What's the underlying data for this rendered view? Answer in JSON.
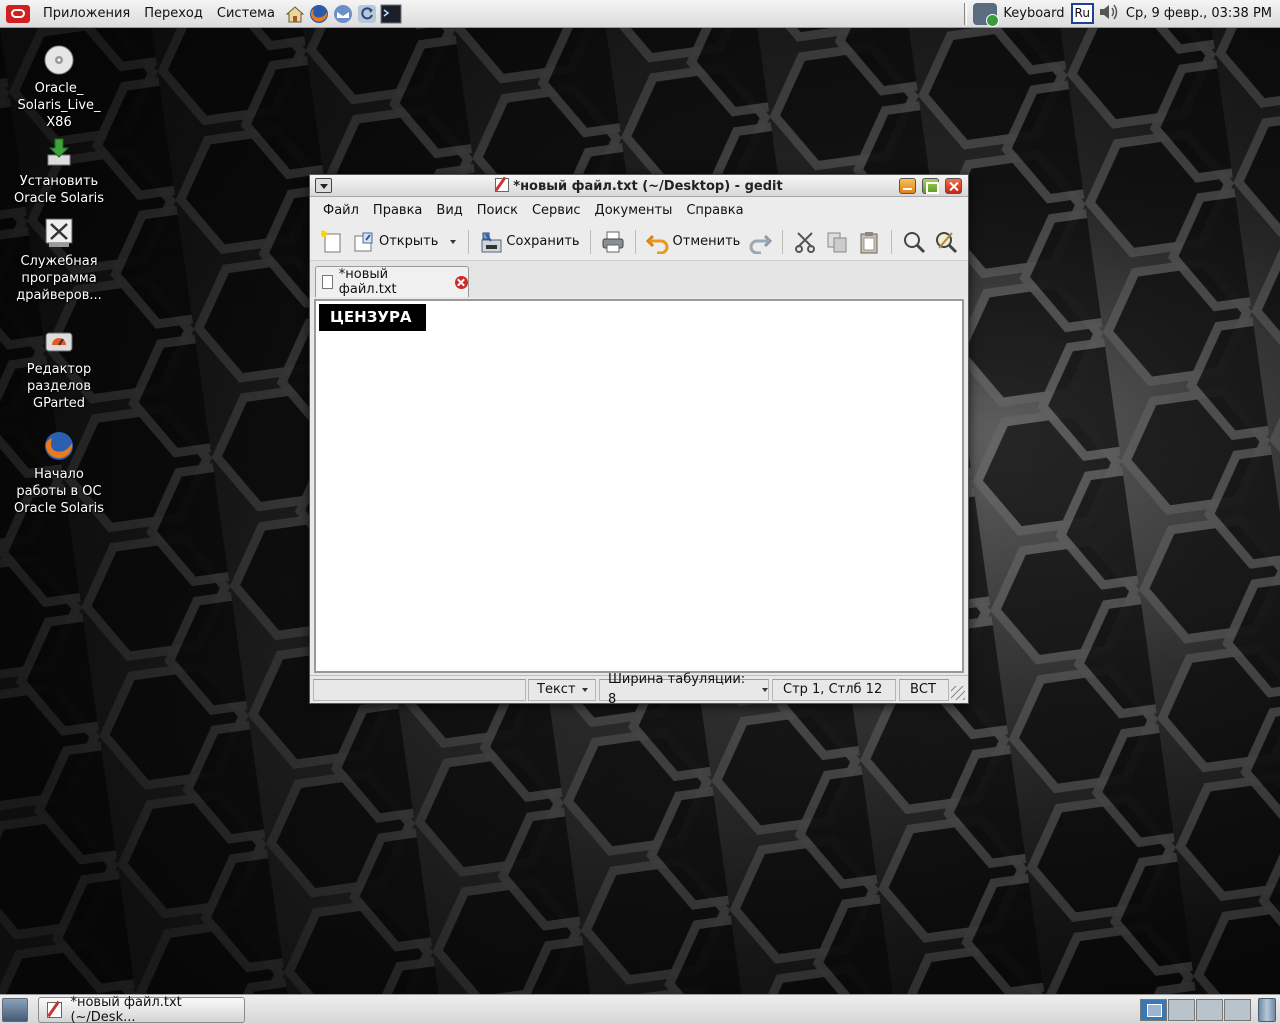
{
  "top_panel": {
    "menus": [
      "Приложения",
      "Переход",
      "Система"
    ],
    "keyboard_label": "Keyboard",
    "language": "Ru",
    "clock": "Ср,  9 февр., 03:38 PM"
  },
  "desktop_icons": [
    {
      "label": "Oracle_\nSolaris_Live_\nX86",
      "icon": "disc-icon"
    },
    {
      "label": "Установить\nOracle Solaris",
      "icon": "install-icon"
    },
    {
      "label": "Служебная\nпрограмма\nдрайверов...",
      "icon": "driver-utility-icon"
    },
    {
      "label": "Редактор\nразделов\nGParted",
      "icon": "gparted-icon"
    },
    {
      "label": "Начало\nработы в ОС\nOracle Solaris",
      "icon": "firefox-icon"
    }
  ],
  "gedit": {
    "title": "*новый файл.txt (~/Desktop) - gedit",
    "menus": [
      "Файл",
      "Правка",
      "Вид",
      "Поиск",
      "Сервис",
      "Документы",
      "Справка"
    ],
    "toolbar": {
      "open_label": "Открыть",
      "save_label": "Сохранить",
      "undo_label": "Отменить"
    },
    "tab_label": "*новый файл.txt",
    "content_text": "ЦЕНЗУРА",
    "status": {
      "language": "Текст",
      "tab_width_label": "Ширина табуляции:  8",
      "position": "Стр 1, Стлб 12",
      "mode": "ВСТ"
    }
  },
  "taskbar": {
    "window_button": "*новый файл.txt (~/Desk..."
  },
  "colors": {
    "close_red": "#c42712",
    "censor_bg": "#000000",
    "workspace_active": "#3a78b5"
  }
}
